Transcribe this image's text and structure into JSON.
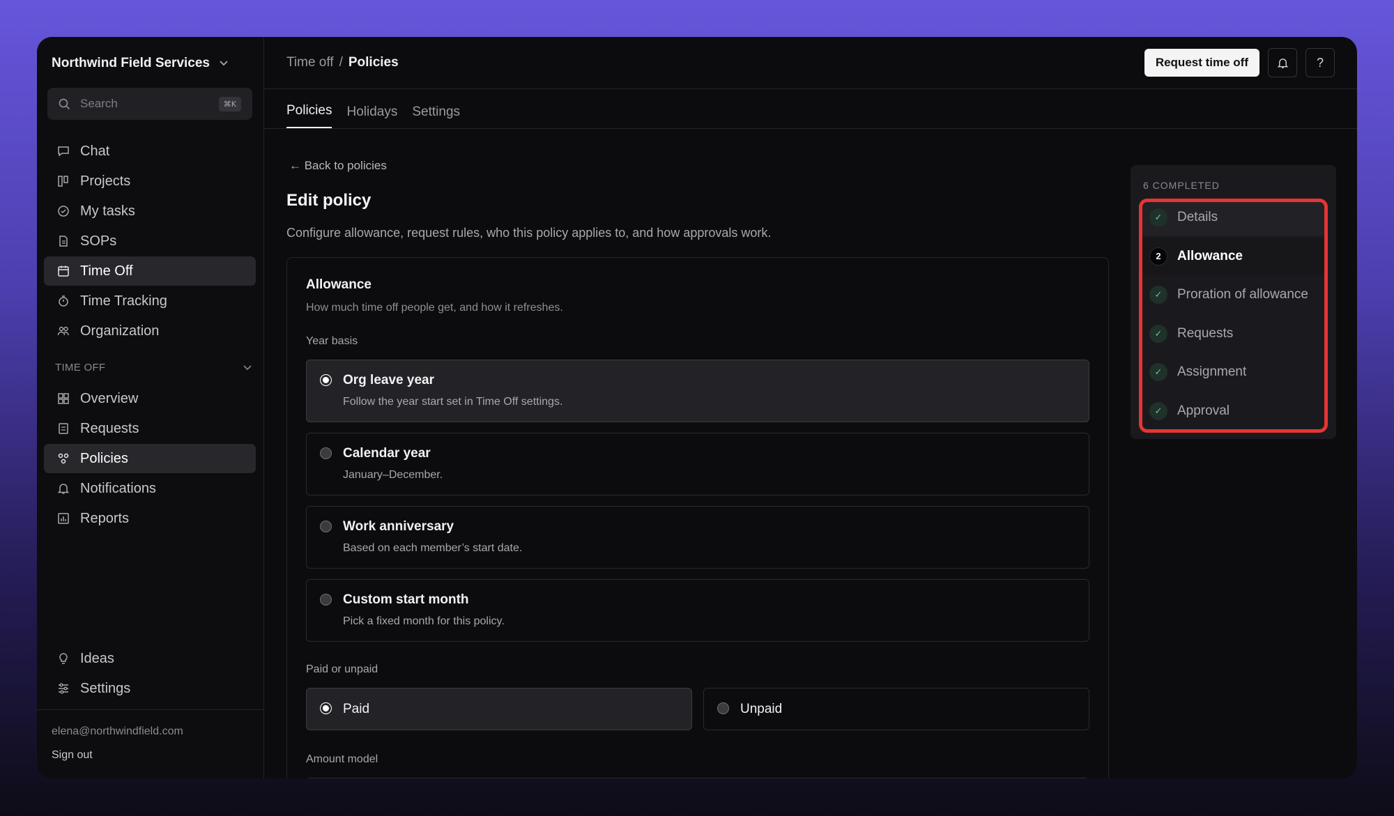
{
  "org": {
    "name": "Northwind Field Services"
  },
  "search": {
    "placeholder": "Search",
    "shortcut": "⌘K"
  },
  "nav_main": [
    {
      "label": "Chat",
      "icon": "chat-icon"
    },
    {
      "label": "Projects",
      "icon": "projects-icon"
    },
    {
      "label": "My tasks",
      "icon": "tasks-icon"
    },
    {
      "label": "SOPs",
      "icon": "document-icon"
    },
    {
      "label": "Time Off",
      "icon": "calendar-icon",
      "active": true
    },
    {
      "label": "Time Tracking",
      "icon": "stopwatch-icon"
    },
    {
      "label": "Organization",
      "icon": "people-icon"
    }
  ],
  "section": {
    "label": "TIME OFF"
  },
  "nav_timeoff": [
    {
      "label": "Overview",
      "icon": "grid-icon"
    },
    {
      "label": "Requests",
      "icon": "list-icon"
    },
    {
      "label": "Policies",
      "icon": "policies-icon",
      "active": true
    },
    {
      "label": "Notifications",
      "icon": "bell-icon"
    },
    {
      "label": "Reports",
      "icon": "chart-icon"
    }
  ],
  "nav_bottom": [
    {
      "label": "Ideas",
      "icon": "lightbulb-icon"
    },
    {
      "label": "Settings",
      "icon": "sliders-icon"
    }
  ],
  "user": {
    "email": "elena@northwindfield.com",
    "signout": "Sign out"
  },
  "breadcrumb": {
    "parent": "Time off",
    "sep": "/",
    "current": "Policies"
  },
  "topbar": {
    "request_label": "Request time off",
    "help": "?"
  },
  "tabs": [
    "Policies",
    "Holidays",
    "Settings"
  ],
  "page": {
    "back": "← Back to policies",
    "title": "Edit policy",
    "description": "Configure allowance, request rules, who this policy applies to, and how approvals work."
  },
  "allowance": {
    "title": "Allowance",
    "subtitle": "How much time off people get, and how it refreshes.",
    "year_basis_label": "Year basis",
    "year_options": [
      {
        "title": "Org leave year",
        "desc": "Follow the year start set in Time Off settings.",
        "selected": true
      },
      {
        "title": "Calendar year",
        "desc": "January–December."
      },
      {
        "title": "Work anniversary",
        "desc": "Based on each member’s start date."
      },
      {
        "title": "Custom start month",
        "desc": "Pick a fixed month for this policy."
      }
    ],
    "paid_label": "Paid or unpaid",
    "paid_options": [
      {
        "title": "Paid",
        "selected": true
      },
      {
        "title": "Unpaid"
      }
    ],
    "amount_label": "Amount model"
  },
  "steps": {
    "header": "6 COMPLETED",
    "items": [
      {
        "label": "Details",
        "state": "done"
      },
      {
        "label": "Allowance",
        "state": "current",
        "number": "2"
      },
      {
        "label": "Proration of allowance",
        "state": "done"
      },
      {
        "label": "Requests",
        "state": "done"
      },
      {
        "label": "Assignment",
        "state": "done"
      },
      {
        "label": "Approval",
        "state": "done"
      }
    ]
  },
  "colors": {
    "highlight": "#e53535",
    "check": "#6ec48f",
    "accent_bg": "#6656da"
  }
}
